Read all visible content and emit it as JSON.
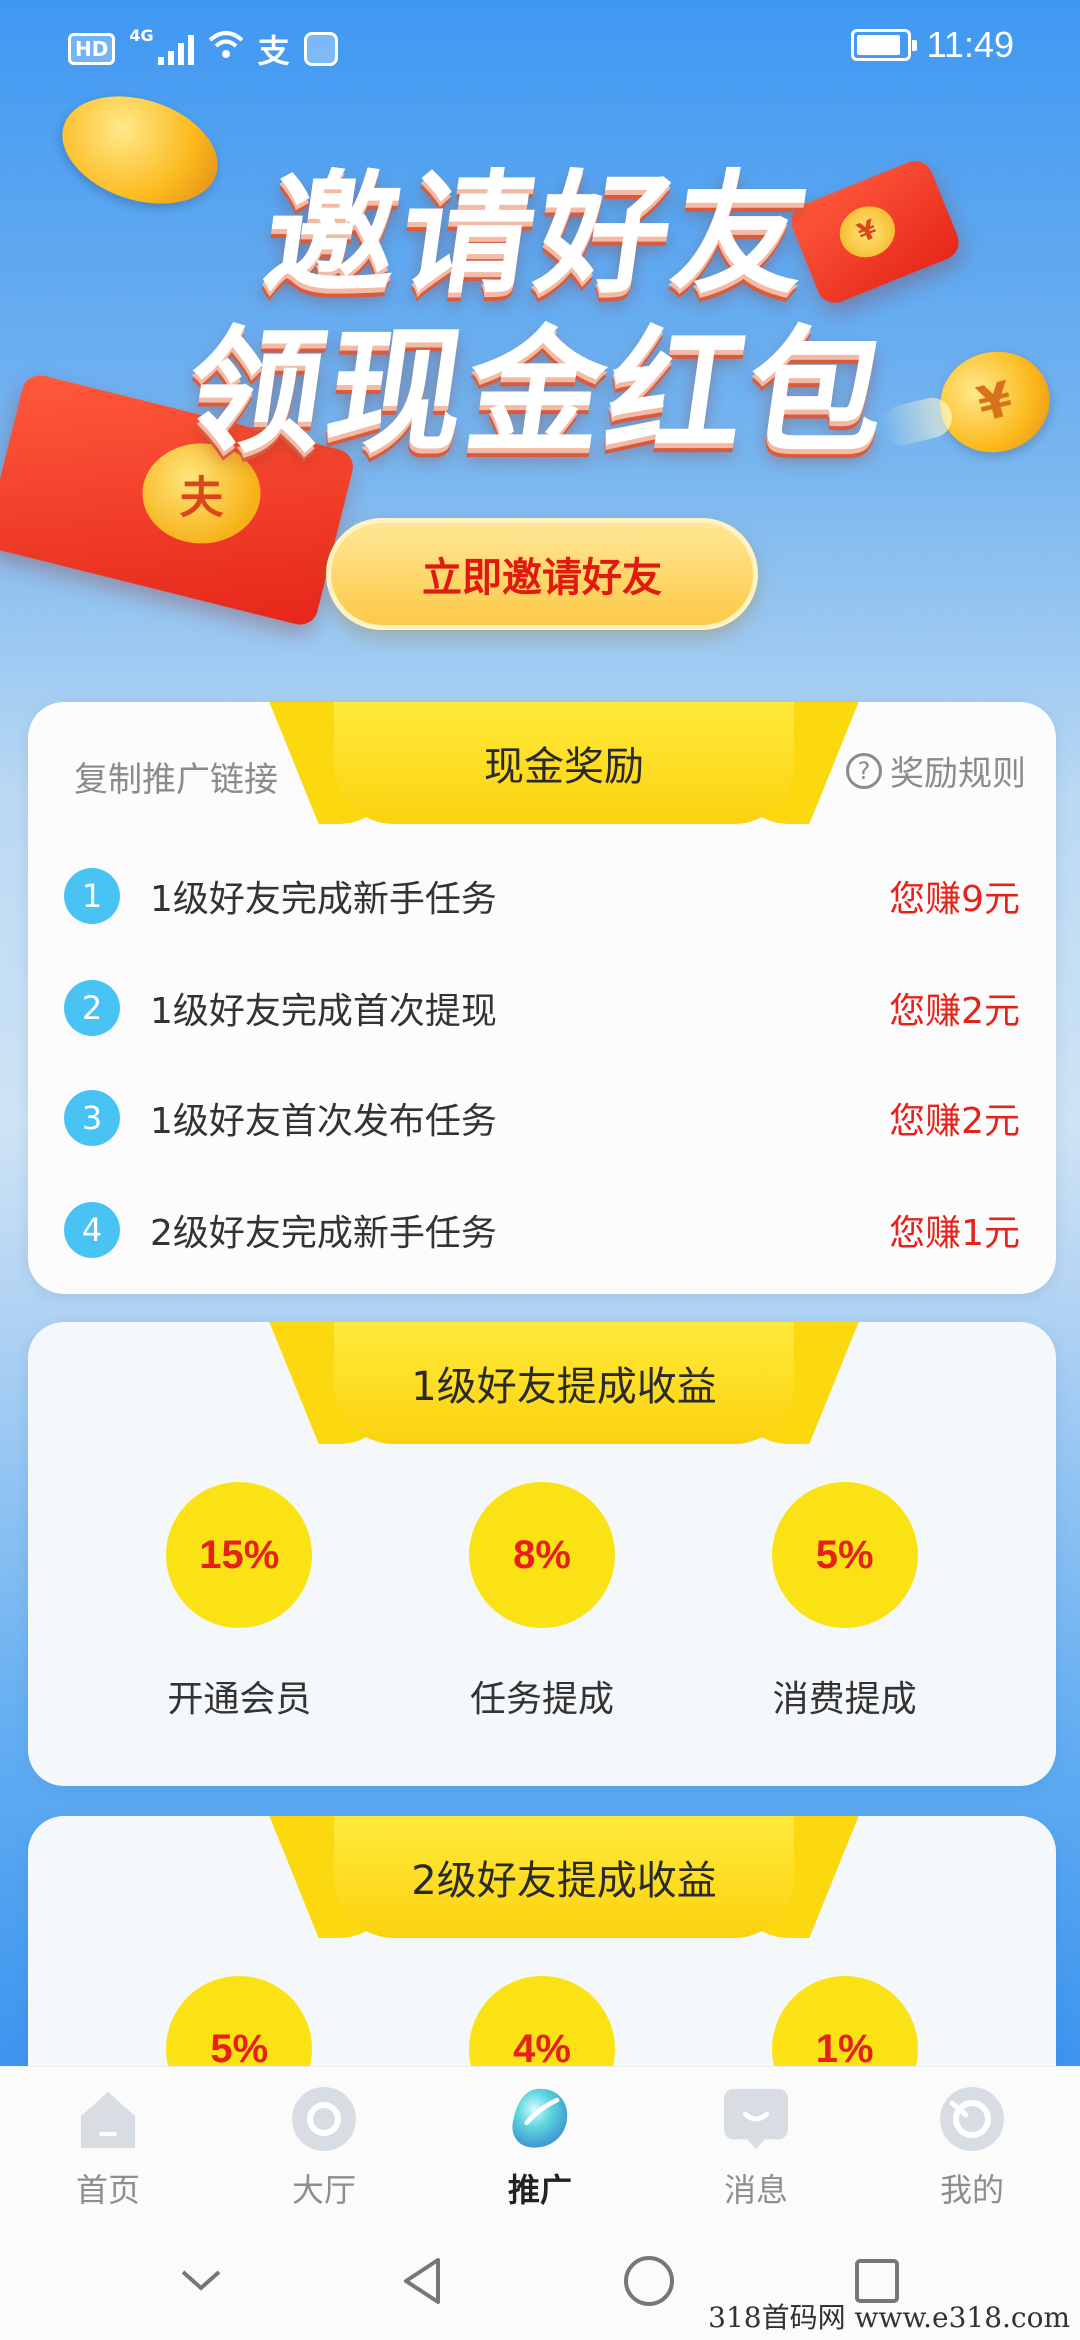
{
  "status_bar": {
    "hd": "HD",
    "network": "4G",
    "alipay": "支",
    "battery_level": 0.9,
    "time": "11:49"
  },
  "hero": {
    "line1": "邀请好友",
    "line2": "领现金红包",
    "coin_symbol": "¥",
    "envelope_seal": "夫",
    "invite_button": "立即邀请好友"
  },
  "cash_rewards": {
    "title": "现金奖励",
    "copy_link": "复制推广链接",
    "rules_icon": "?",
    "rules": "奖励规则",
    "items": [
      {
        "num": "1",
        "text": "1级好友完成新手任务",
        "amount": "您赚9元"
      },
      {
        "num": "2",
        "text": "1级好友完成首次提现",
        "amount": "您赚2元"
      },
      {
        "num": "3",
        "text": "1级好友首次发布任务",
        "amount": "您赚2元"
      },
      {
        "num": "4",
        "text": "2级好友完成新手任务",
        "amount": "您赚1元"
      }
    ]
  },
  "level1": {
    "title": "1级好友提成收益",
    "items": [
      {
        "pct": "15%",
        "label": "开通会员"
      },
      {
        "pct": "8%",
        "label": "任务提成"
      },
      {
        "pct": "5%",
        "label": "消费提成"
      }
    ]
  },
  "level2": {
    "title": "2级好友提成收益",
    "items": [
      {
        "pct": "5%"
      },
      {
        "pct": "4%"
      },
      {
        "pct": "1%"
      }
    ]
  },
  "nav": {
    "items": [
      {
        "label": "首页",
        "icon": "home-icon"
      },
      {
        "label": "大厅",
        "icon": "hall-icon"
      },
      {
        "label": "推广",
        "icon": "promote-icon"
      },
      {
        "label": "消息",
        "icon": "message-icon"
      },
      {
        "label": "我的",
        "icon": "profile-icon"
      }
    ],
    "active_index": 2
  },
  "watermark": "318首码网 www.e318.com"
}
